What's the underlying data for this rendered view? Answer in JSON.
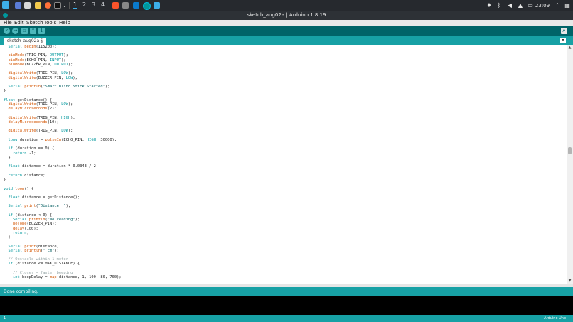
{
  "taskbar": {
    "workspaces": [
      "1",
      "2",
      "3",
      "4"
    ],
    "clock": "23:09"
  },
  "window": {
    "title": "sketch_aug02a | Arduino 1.8.19"
  },
  "menu": {
    "file": "File",
    "edit": "Edit",
    "sketch": "Sketch",
    "tools": "Tools",
    "help": "Help"
  },
  "toolbar": {
    "verify": "✓",
    "upload": "→",
    "new": "▫",
    "open": "↑",
    "save": "↓",
    "serial_monitor": "⌕"
  },
  "tab": {
    "name": "sketch_aug02a §",
    "menu_arrow": "▾"
  },
  "status": {
    "message": "Done compiling.",
    "line_number": "1",
    "board": "Arduino Uno"
  }
}
